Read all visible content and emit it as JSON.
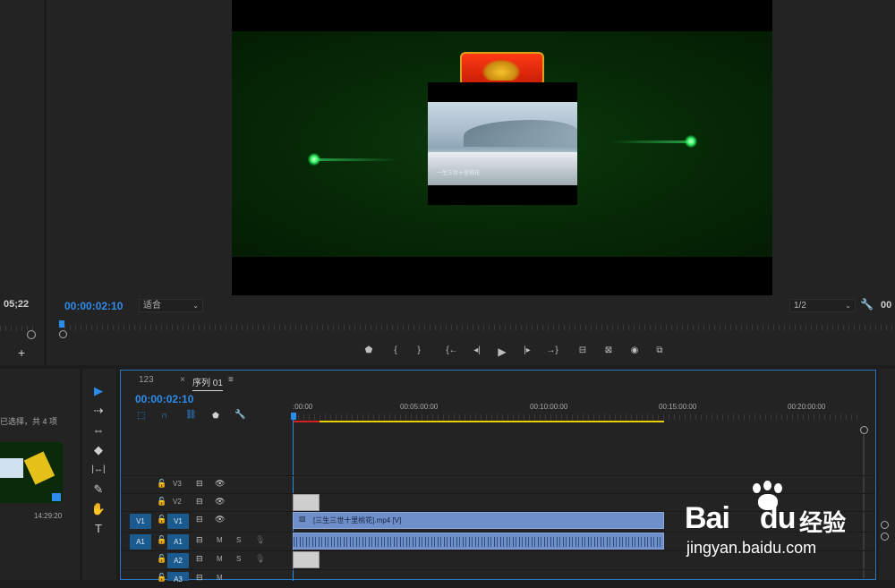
{
  "source": {
    "timecode": "05;22",
    "add_label": "+"
  },
  "program": {
    "timecode": "00:00:02:10",
    "fit_label": "适合",
    "resolution_label": "1/2",
    "timecode_right": "00",
    "inset_caption": "一生三世十里桃花"
  },
  "transport": {
    "marker": "⬟",
    "in": "{",
    "out": "}",
    "goto_in": "{←",
    "step_back": "◂|",
    "play": "▶",
    "step_fwd": "|▸",
    "goto_out": "→}",
    "lift": "⊟",
    "extract": "⊠",
    "export_frame": "◉",
    "compare": "⧉"
  },
  "project": {
    "selection_text": "已选择，共 4 项",
    "clip_duration": "14:29:20"
  },
  "tools": [
    "▶",
    "⇢",
    "⇔",
    "◆",
    "|↔|",
    "✎",
    "✋",
    "T"
  ],
  "timeline": {
    "tab_other": "123",
    "tab_close": "×",
    "tab_active": "序列 01",
    "tab_menu": "≡",
    "timecode": "00:00:02:10",
    "ruler": [
      ":00:00",
      "00:05:00:00",
      "00:10:00:00",
      "00:15:00:00",
      "00:20:00:00"
    ],
    "tracks": {
      "v3": "V3",
      "v2": "V2",
      "v1": "V1",
      "v1_src": "V1",
      "a1": "A1",
      "a1_src": "A1",
      "a2": "A2",
      "a3": "A3",
      "m": "M",
      "s": "S"
    },
    "clip_v1_label": "[三生三世十里桃花].mp4 [V]"
  },
  "watermark": {
    "brand": "Bai",
    "brand2": "du",
    "suffix": "经验",
    "url": "jingyan.baidu.com"
  },
  "colors": {
    "accent": "#2d8ceb",
    "clip": "#6f8fcb",
    "workarea": "#e8d100",
    "playhead": "#2d8ceb"
  }
}
